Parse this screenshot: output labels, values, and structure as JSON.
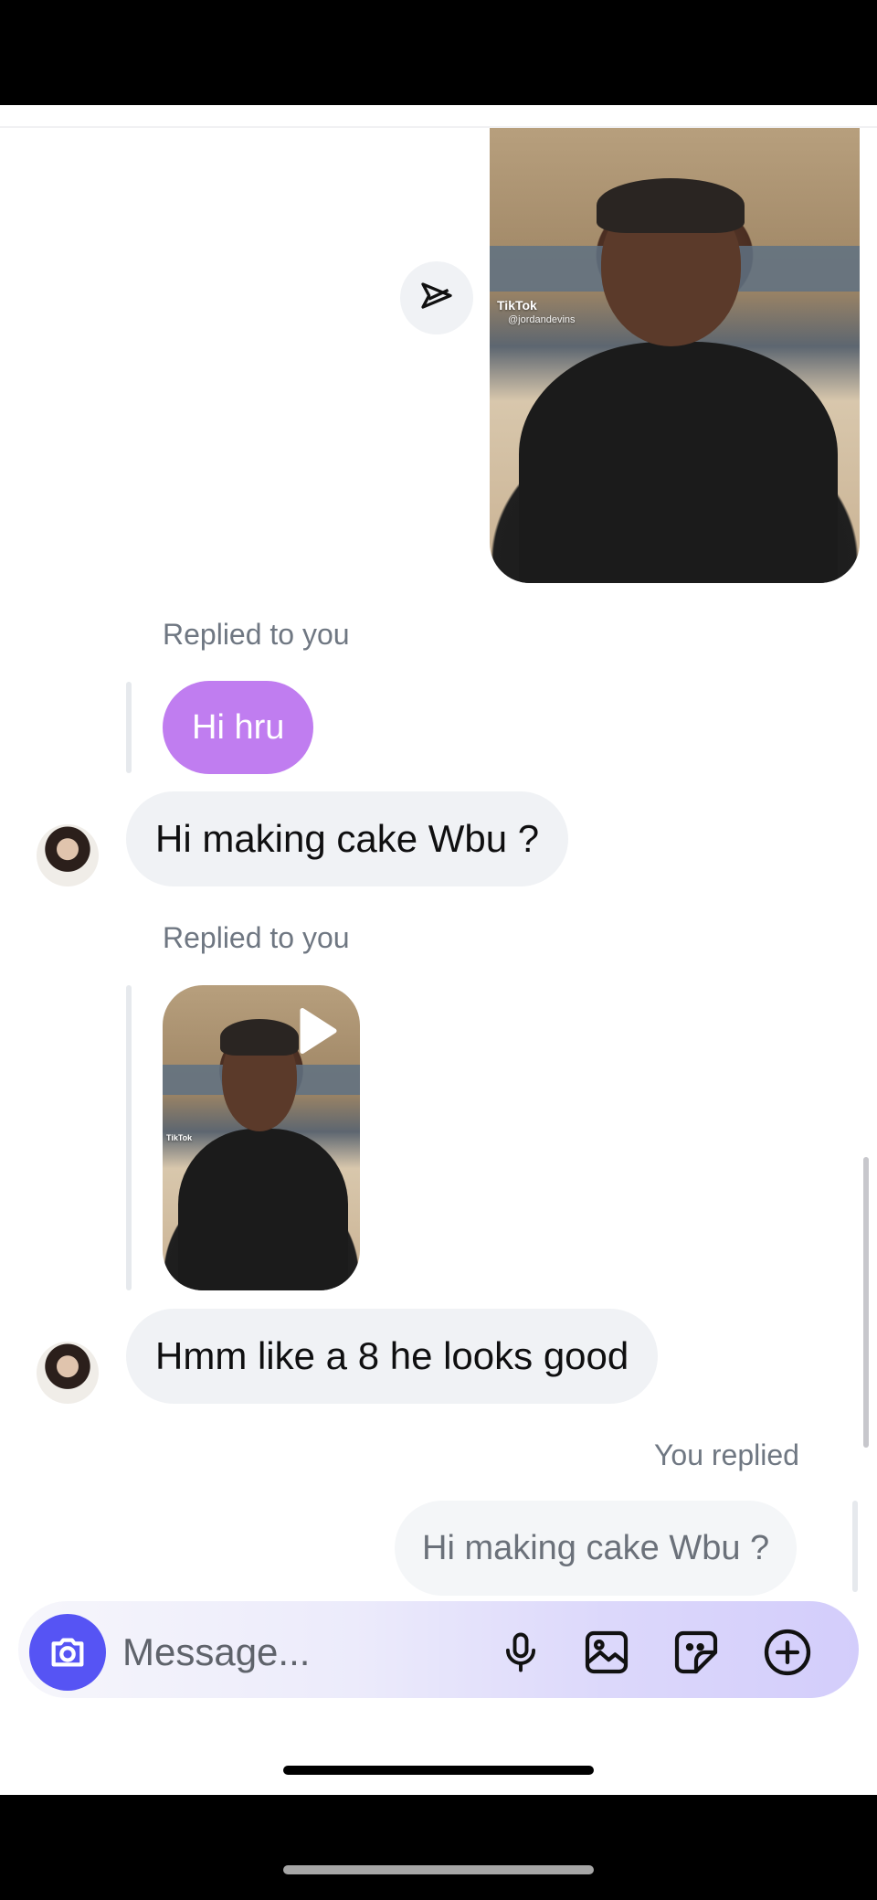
{
  "thread": {
    "messages": [
      {
        "type": "shared_video",
        "sender": "me",
        "watermark": "TikTok",
        "handle": "@jordandevins"
      },
      {
        "type": "reply_context",
        "label": "Replied to you",
        "quoted_text": "Hi hru"
      },
      {
        "type": "text",
        "sender": "them",
        "text": "Hi making cake Wbu ?"
      },
      {
        "type": "reply_context",
        "label": "Replied to you",
        "quoted_media": "video",
        "watermark": "TikTok"
      },
      {
        "type": "text",
        "sender": "them",
        "text": "Hmm like a 8 he looks good"
      },
      {
        "type": "reply_context",
        "label": "You replied",
        "quoted_text": "Hi making cake Wbu ?"
      }
    ]
  },
  "composer": {
    "placeholder": "Message...",
    "icons": [
      "camera-icon",
      "microphone-icon",
      "gallery-icon",
      "sticker-icon",
      "plus-icon"
    ]
  },
  "icons": {
    "share": "send-paper-plane-icon",
    "play": "play-icon"
  },
  "colors": {
    "accent": "#5654f4",
    "quoted_bubble_purple": "#c07df0",
    "incoming_bubble": "#f0f2f5",
    "label_gray": "#6f7782"
  }
}
